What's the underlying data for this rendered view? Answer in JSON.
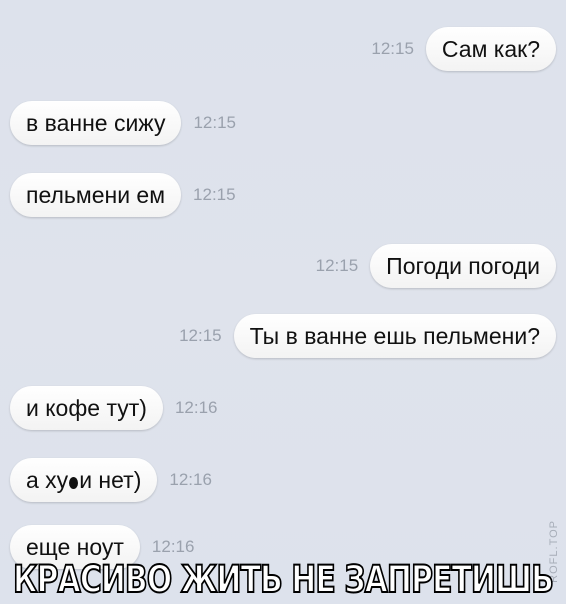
{
  "messages": [
    {
      "side": "right",
      "text": "Сам как?",
      "time": "12:15"
    },
    {
      "side": "left",
      "text": "в ванне сижу",
      "time": "12:15"
    },
    {
      "side": "left",
      "text": "пельмени ем",
      "time": "12:15"
    },
    {
      "side": "right",
      "text": "Погоди погоди",
      "time": "12:15"
    },
    {
      "side": "right",
      "text": "Ты в ванне ешь пельмени?",
      "time": "12:15"
    },
    {
      "side": "left",
      "text": "и кофе тут)",
      "time": "12:16"
    },
    {
      "side": "left",
      "text_before": "а ху",
      "text_after": "и нет)",
      "time": "12:16"
    },
    {
      "side": "left",
      "text": "еще ноут",
      "time": "12:16"
    }
  ],
  "banner": "КРАСИВО ЖИТЬ НЕ ЗАПРЕТИШЬ",
  "watermark": "ROFL.TOP"
}
